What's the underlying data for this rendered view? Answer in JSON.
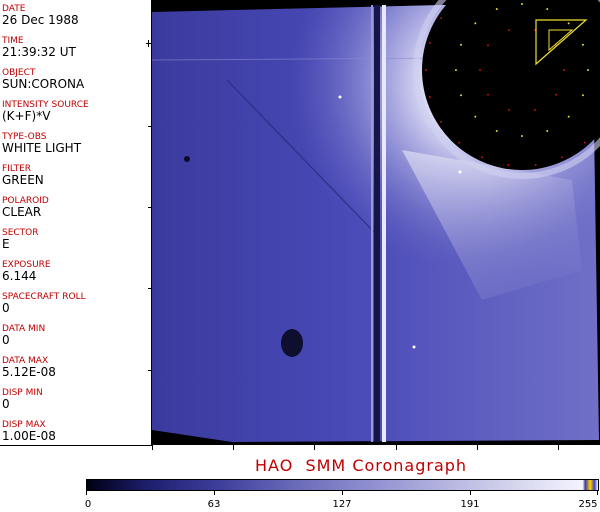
{
  "metadata": {
    "fields": [
      {
        "label": "DATE",
        "value": "26 Dec 1988"
      },
      {
        "label": "TIME",
        "value": "21:39:32 UT"
      },
      {
        "label": "OBJECT",
        "value": "SUN:CORONA"
      },
      {
        "label": "INTENSITY SOURCE",
        "value": "(K+F)*V"
      },
      {
        "label": "TYPE-OBS",
        "value": "WHITE LIGHT"
      },
      {
        "label": "FILTER",
        "value": "GREEN"
      },
      {
        "label": "POLAROID",
        "value": "CLEAR"
      },
      {
        "label": "SECTOR",
        "value": "E"
      },
      {
        "label": "EXPOSURE",
        "value": "6.144"
      },
      {
        "label": "SPACECRAFT ROLL",
        "value": "0"
      },
      {
        "label": "DATA MIN",
        "value": "0"
      },
      {
        "label": "DATA MAX",
        "value": "5.12E-08"
      },
      {
        "label": "DISP MIN",
        "value": "0"
      },
      {
        "label": "DISP MAX",
        "value": "1.00E-08"
      }
    ]
  },
  "caption": "HAO  SMM Coronagraph",
  "colorbar": {
    "labels": [
      "0",
      "63",
      "127",
      "191",
      "255"
    ]
  },
  "colors": {
    "label_red": "#c00000",
    "occulter_dot_red": "#e01010",
    "occulter_dot_yellow": "#f0e030",
    "corona_blue": "#4a4ab4"
  }
}
